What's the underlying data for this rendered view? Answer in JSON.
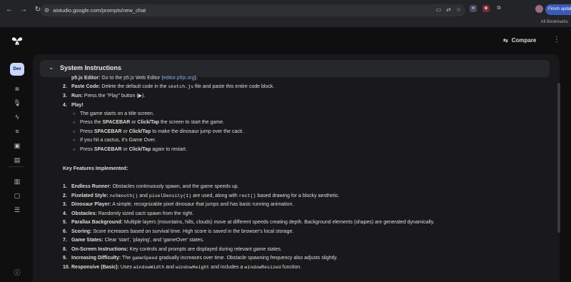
{
  "browser": {
    "url": "aistudio.google.com/prompts/new_chat",
    "refresh_label": "Finish update",
    "bookmark_label": "All Bookmarks"
  },
  "header": {
    "compare_label": "Compare"
  },
  "rail": {
    "chip_label": "Dev"
  },
  "system_instructions": {
    "title": "System Instructions"
  },
  "steps": [
    {
      "num": "",
      "label": "p5.js Editor:",
      "text": " Go to the p5.js Web Editor (",
      "link": "editor.p5js.org",
      "tail": ")."
    },
    {
      "num": "2.",
      "label": "Paste Code:",
      "pre": " Delete the default code in the ",
      "code": "sketch.js",
      "post": " file and paste this entire code block."
    },
    {
      "num": "3.",
      "label": "Run:",
      "text": " Press the \"Play\" button (▶)."
    },
    {
      "num": "4.",
      "label": "Play!",
      "text": ""
    }
  ],
  "play_bullets": [
    {
      "segs": [
        {
          "t": "The game starts on a title screen.",
          "b": false
        }
      ]
    },
    {
      "segs": [
        {
          "t": "Press the ",
          "b": false
        },
        {
          "t": "SPACEBAR",
          "b": true
        },
        {
          "t": " or ",
          "b": false
        },
        {
          "t": "Click/Tap",
          "b": true
        },
        {
          "t": " the screen to start the game.",
          "b": false
        }
      ]
    },
    {
      "segs": [
        {
          "t": "Press ",
          "b": false
        },
        {
          "t": "SPACEBAR",
          "b": true
        },
        {
          "t": " or ",
          "b": false
        },
        {
          "t": "Click/Tap",
          "b": true
        },
        {
          "t": " to make the dinosaur jump over the cacti.",
          "b": false
        }
      ]
    },
    {
      "segs": [
        {
          "t": "If you hit a cactus, it's Game Over.",
          "b": false
        }
      ]
    },
    {
      "segs": [
        {
          "t": "Press ",
          "b": false
        },
        {
          "t": "SPACEBAR",
          "b": true
        },
        {
          "t": " or ",
          "b": false
        },
        {
          "t": "Click/Tap",
          "b": true
        },
        {
          "t": " again to restart.",
          "b": false
        }
      ]
    }
  ],
  "features_heading": "Key Features Implemented:",
  "features": [
    {
      "num": "1.",
      "segs": [
        {
          "t": "Endless Runner:",
          "k": "b"
        },
        {
          "t": " Obstacles continuously spawn, and the game speeds up.",
          "k": "n"
        }
      ]
    },
    {
      "num": "2.",
      "segs": [
        {
          "t": "Pixelated Style:",
          "k": "b"
        },
        {
          "t": " ",
          "k": "n"
        },
        {
          "t": "noSmooth()",
          "k": "m"
        },
        {
          "t": " and ",
          "k": "n"
        },
        {
          "t": "pixelDensity(1)",
          "k": "m"
        },
        {
          "t": " are used, along with ",
          "k": "n"
        },
        {
          "t": "rect()",
          "k": "m"
        },
        {
          "t": " based drawing for a blocky aesthetic.",
          "k": "n"
        }
      ]
    },
    {
      "num": "3.",
      "segs": [
        {
          "t": "Dinosaur Player:",
          "k": "b"
        },
        {
          "t": " A simple, recognizable pixel dinosaur that jumps and has basic running animation.",
          "k": "n"
        }
      ]
    },
    {
      "num": "4.",
      "segs": [
        {
          "t": "Obstacles:",
          "k": "b"
        },
        {
          "t": " Randomly sized cacti spawn from the right.",
          "k": "n"
        }
      ]
    },
    {
      "num": "5.",
      "segs": [
        {
          "t": "Parallax Background:",
          "k": "b"
        },
        {
          "t": " Multiple layers (mountains, hills, clouds) move at different speeds creating depth. Background elements (shapes) are generated dynamically.",
          "k": "n"
        }
      ]
    },
    {
      "num": "6.",
      "segs": [
        {
          "t": "Scoring:",
          "k": "b"
        },
        {
          "t": " Score increases based on survival time. High score is saved in the browser's local storage.",
          "k": "n"
        }
      ]
    },
    {
      "num": "7.",
      "segs": [
        {
          "t": "Game States:",
          "k": "b"
        },
        {
          "t": " Clear 'start', 'playing', and 'gameOver' states.",
          "k": "n"
        }
      ]
    },
    {
      "num": "8.",
      "segs": [
        {
          "t": "On-Screen Instructions:",
          "k": "b"
        },
        {
          "t": " Key controls and prompts are displayed during relevant game states.",
          "k": "n"
        }
      ]
    },
    {
      "num": "9.",
      "segs": [
        {
          "t": "Increasing Difficulty:",
          "k": "b"
        },
        {
          "t": " The ",
          "k": "n"
        },
        {
          "t": "gameSpeed",
          "k": "m"
        },
        {
          "t": " gradually increases over time. Obstacle spawning frequency also adjusts slightly.",
          "k": "n"
        }
      ]
    },
    {
      "num": "10.",
      "segs": [
        {
          "t": "Responsive (Basic):",
          "k": "b"
        },
        {
          "t": " Uses ",
          "k": "n"
        },
        {
          "t": "windowWidth",
          "k": "m"
        },
        {
          "t": " and ",
          "k": "n"
        },
        {
          "t": "windowHeight",
          "k": "m"
        },
        {
          "t": " and includes a ",
          "k": "n"
        },
        {
          "t": "windowResized",
          "k": "m"
        },
        {
          "t": " function.",
          "k": "n"
        }
      ]
    }
  ]
}
